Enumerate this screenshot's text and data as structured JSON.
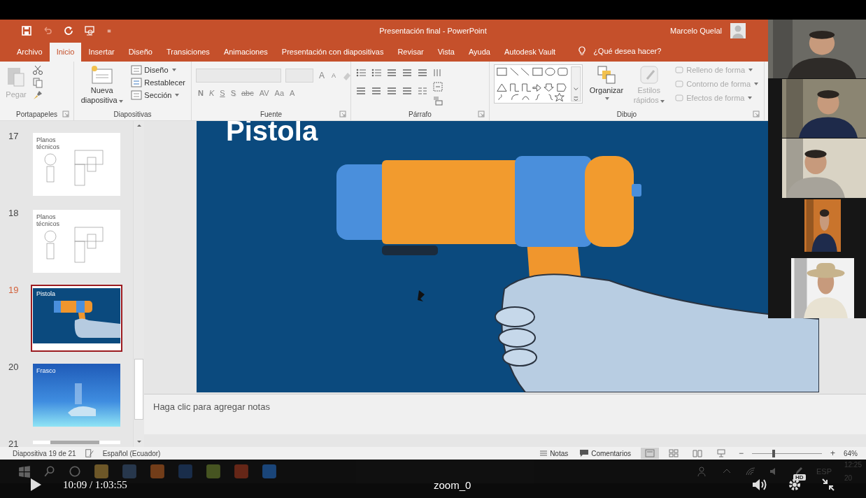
{
  "title_bar": {
    "title": "Presentación final  -  PowerPoint",
    "user": "Marcelo Quelal"
  },
  "tabs": [
    {
      "label": "Archivo",
      "selected": false
    },
    {
      "label": "Inicio",
      "selected": true
    },
    {
      "label": "Insertar",
      "selected": false
    },
    {
      "label": "Diseño",
      "selected": false
    },
    {
      "label": "Transiciones",
      "selected": false
    },
    {
      "label": "Animaciones",
      "selected": false
    },
    {
      "label": "Presentación con diapositivas",
      "selected": false
    },
    {
      "label": "Revisar",
      "selected": false
    },
    {
      "label": "Vista",
      "selected": false
    },
    {
      "label": "Ayuda",
      "selected": false
    },
    {
      "label": "Autodesk Vault",
      "selected": false
    }
  ],
  "tell_me": {
    "placeholder": "¿Qué desea hacer?"
  },
  "ribbon": {
    "clipboard": {
      "label": "Portapapeles",
      "paste": {
        "label": "Pegar",
        "disabled": true
      }
    },
    "slides": {
      "label": "Diapositivas",
      "new_slide": "Nueva diapositiva",
      "buttons": [
        {
          "label": "Diseño"
        },
        {
          "label": "Restablecer"
        },
        {
          "label": "Sección"
        }
      ]
    },
    "font": {
      "label": "Fuente",
      "grow_shrink": [
        "A",
        "A"
      ],
      "buttons": [
        "N",
        "K",
        "S",
        "S",
        "abc",
        "AV",
        "Aa",
        "A"
      ]
    },
    "paragraph": {
      "label": "Párrafo"
    },
    "drawing": {
      "label": "Dibujo",
      "arrange": "Organizar",
      "quick_styles": {
        "label": "Estilos rápidos",
        "disabled": true
      },
      "format_buttons": [
        {
          "label": "Relleno de forma",
          "disabled": true
        },
        {
          "label": "Contorno de forma",
          "disabled": true
        },
        {
          "label": "Efectos de forma",
          "disabled": true
        }
      ]
    }
  },
  "thumbnails": [
    {
      "number": "17",
      "title": "Planos técnicos",
      "kind": "plans",
      "selected": false
    },
    {
      "number": "18",
      "title": "Planos técnicos",
      "kind": "plans",
      "selected": false
    },
    {
      "number": "19",
      "title": "Pistola",
      "kind": "pistol",
      "selected": true
    },
    {
      "number": "20",
      "title": "Frasco",
      "kind": "jar",
      "selected": false
    },
    {
      "number": "21",
      "kind": "partial",
      "selected": false
    }
  ],
  "slide": {
    "title": "Pistola"
  },
  "notes": {
    "placeholder": "Haga clic para agregar notas"
  },
  "status_bar": {
    "slide_info": "Diapositiva 19 de 21",
    "language": "Español (Ecuador)",
    "notes": "Notas",
    "comments": "Comentarios",
    "views": [
      {
        "selected": true
      },
      {
        "selected": false
      },
      {
        "selected": false
      },
      {
        "selected": false
      }
    ],
    "zoom_out": "−",
    "zoom_in": "+",
    "zoom": {
      "level": 0.31,
      "reading": "64%"
    }
  },
  "taskbar": {
    "language": "ESP",
    "clock": "12:25",
    "date": "20"
  },
  "player": {
    "time": "10:09 / 1:03:55",
    "title": "zoom_0",
    "quality": "HD"
  }
}
